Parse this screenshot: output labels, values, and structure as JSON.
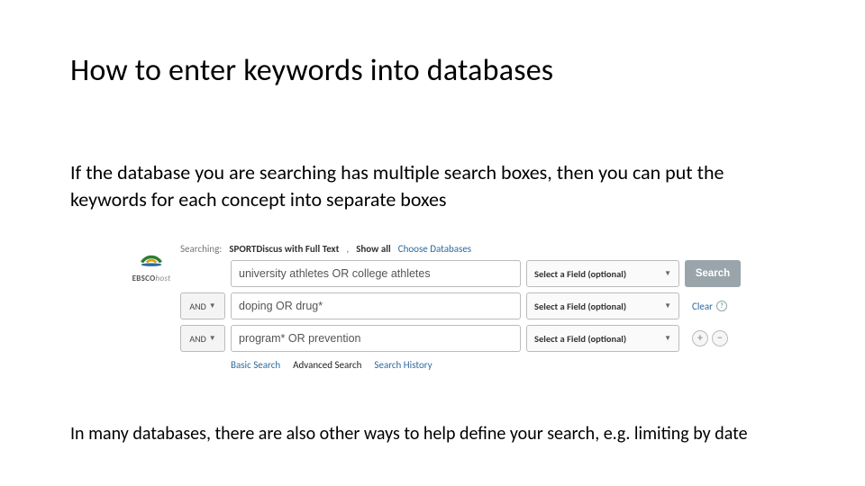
{
  "title": "How to enter keywords into databases",
  "intro": "If the database you are searching has multiple search boxes, then you can put the keywords for each concept into separate boxes",
  "outro": "In many databases, there are also other ways to help define your search, e.g. limiting by date",
  "ebsco": {
    "logo_brand": "EBSCO",
    "logo_suffix": "host",
    "crumb_prefix": "Searching:",
    "crumb_db": "SPORTDiscus with Full Text",
    "crumb_showall": "Show all",
    "crumb_choose": "Choose Databases",
    "field_label": "Select a Field (optional)",
    "search_label": "Search",
    "clear_label": "Clear",
    "help_glyph": "?",
    "plus_glyph": "+",
    "minus_glyph": "−",
    "rows": [
      {
        "operator": null,
        "keywords": "university athletes OR college athletes"
      },
      {
        "operator": "AND",
        "keywords": "doping OR drug*"
      },
      {
        "operator": "AND",
        "keywords": "program* OR prevention"
      }
    ],
    "modes": {
      "basic": "Basic Search",
      "advanced": "Advanced Search",
      "history": "Search History"
    }
  }
}
